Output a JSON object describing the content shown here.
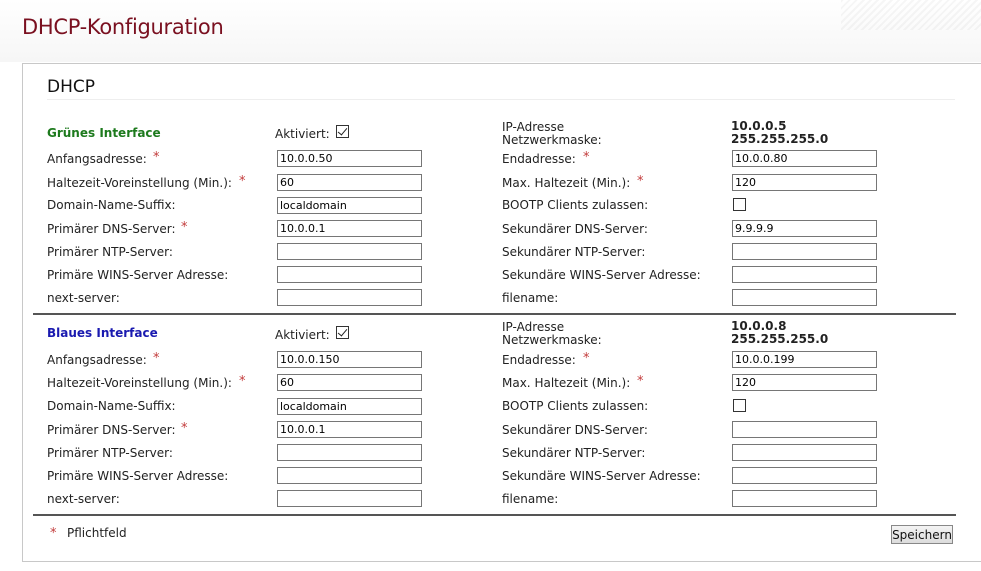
{
  "page_title": "DHCP-Konfiguration",
  "section_title": "DHCP",
  "required_mark": "*",
  "labels": {
    "aktiviert": "Aktiviert:",
    "ip_adresse": "IP-Adresse",
    "netzwerkmaske": "Netzwerkmaske:",
    "anfangsadresse": "Anfangsadresse:",
    "endadresse": "Endadresse:",
    "haltezeit": "Haltezeit-Voreinstellung (Min.):",
    "max_haltezeit": "Max. Haltezeit (Min.):",
    "domain_suffix": "Domain-Name-Suffix:",
    "bootp": "BOOTP Clients zulassen:",
    "primary_dns": "Primärer DNS-Server:",
    "secondary_dns": "Sekundärer DNS-Server:",
    "primary_ntp": "Primärer NTP-Server:",
    "secondary_ntp": "Sekundärer NTP-Server:",
    "primary_wins": "Primäre WINS-Server Adresse:",
    "secondary_wins": "Sekundäre WINS-Server Adresse:",
    "next_server": "next-server:",
    "filename": "filename:"
  },
  "green": {
    "name": "Grünes Interface",
    "enabled": true,
    "ip": "10.0.0.5",
    "netmask": "255.255.255.0",
    "start": "10.0.0.50",
    "end": "10.0.0.80",
    "lease_default": "60",
    "lease_max": "120",
    "domain": "localdomain",
    "bootp": false,
    "dns1": "10.0.0.1",
    "dns2": "9.9.9.9",
    "ntp1": "",
    "ntp2": "",
    "wins1": "",
    "wins2": "",
    "next_server": "",
    "filename": ""
  },
  "blue": {
    "name": "Blaues Interface",
    "enabled": true,
    "ip": "10.0.0.8",
    "netmask": "255.255.255.0",
    "start": "10.0.0.150",
    "end": "10.0.0.199",
    "lease_default": "60",
    "lease_max": "120",
    "domain": "localdomain",
    "bootp": false,
    "dns1": "10.0.0.1",
    "dns2": "",
    "ntp1": "",
    "ntp2": "",
    "wins1": "",
    "wins2": "",
    "next_server": "",
    "filename": ""
  },
  "footer": {
    "required_legend": "Pflichtfeld",
    "save_label": "Speichern"
  },
  "colors": {
    "title": "#7a1020",
    "green_interface": "#1d7a1d",
    "blue_interface": "#1a1ab0",
    "required": "#c23a3a"
  }
}
